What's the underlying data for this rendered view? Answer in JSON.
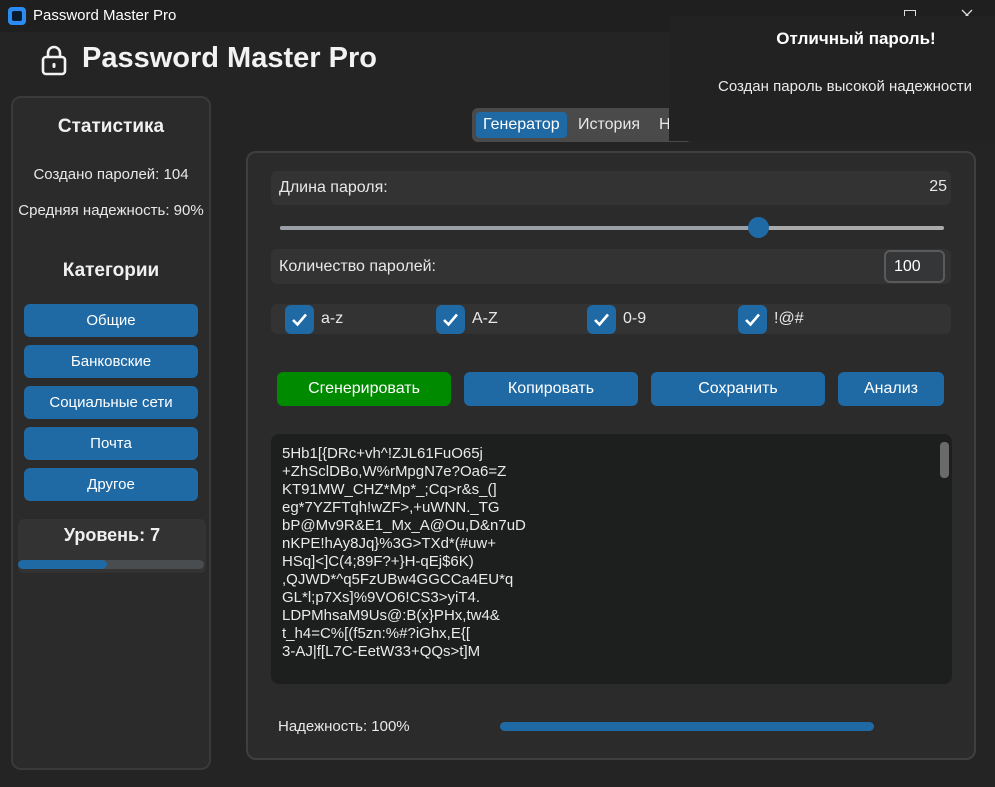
{
  "window": {
    "title": "Password Master Pro"
  },
  "header": {
    "title": "Password Master Pro"
  },
  "sidebar": {
    "stats_title": "Статистика",
    "created": "Создано паролей: 104",
    "avg_strength": "Средняя надежность: 90%",
    "categories_title": "Категории",
    "categories": [
      "Общие",
      "Банковские",
      "Социальные сети",
      "Почта",
      "Другое"
    ],
    "level_label": "Уровень: 7",
    "level_progress": 0.48
  },
  "tabs": [
    "Генератор",
    "История",
    "Н"
  ],
  "generator": {
    "length_label": "Длина пароля:",
    "length_value": "25",
    "slider_fraction": 0.72,
    "count_label": "Количество паролей:",
    "count_value": "100",
    "options": [
      {
        "label": "a-z",
        "checked": true
      },
      {
        "label": "A-Z",
        "checked": true
      },
      {
        "label": "0-9",
        "checked": true
      },
      {
        "label": "!@#",
        "checked": true
      }
    ],
    "buttons": {
      "generate": "Сгенерировать",
      "copy": "Копировать",
      "save": "Сохранить",
      "analyze": "Анализ"
    },
    "output_lines": [
      "5Hb1[{DRc+vh^!ZJL61FuO65j",
      "+ZhSclDBo,W%rMpgN7e?Oa6=Z",
      "KT91MW_CHZ*Mp*_;Cq>r&s_(]",
      "eg*7YZFTqh!wZF>,+uWNN._TG",
      "bP@Mv9R&E1_Mx_A@Ou,D&n7uD",
      "nKPE!hAy8Jq}%3G>TXd*(#uw+",
      "HSq]<]C(4;89F?+}H-qEj$6K)",
      ",QJWD*^q5FzUBw4GGCCa4EU*q",
      "GL*l;p7Xs]%9VO6!CS3>yiT4.",
      "LDPMhsaM9Us@:B(x}PHx,tw4&",
      "t_h4=C%[(f5zn:%#?iGhx,E{[",
      "3-AJ|f[L7C-EetW33+QQs>t]M"
    ],
    "strength_label": "Надежность: 100%",
    "strength_progress": 1.0
  },
  "toast": {
    "title": "Отличный пароль!",
    "message": "Создан пароль высокой надежности"
  },
  "colors": {
    "accent": "#1f6aa5",
    "generate": "#008a00",
    "background": "#242424"
  }
}
